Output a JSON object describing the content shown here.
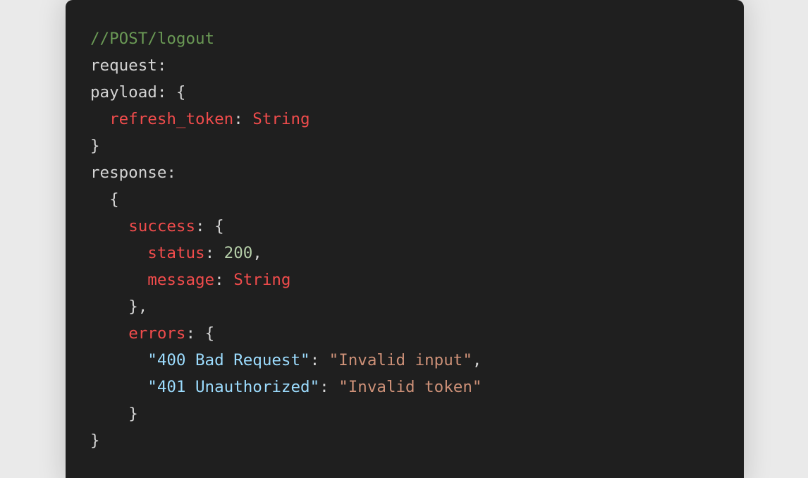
{
  "code": {
    "comment": "//POST/logout",
    "request_label": "request:",
    "payload_label": "payload:",
    "open_brace": "{",
    "close_brace": "}",
    "refresh_token_key": "refresh_token",
    "colon_sep": ": ",
    "refresh_token_type": "String",
    "response_label": "response:",
    "success_key": "success",
    "status_key": "status",
    "status_value": "200",
    "comma": ",",
    "message_key": "message",
    "message_type": "String",
    "close_brace_comma": "},",
    "errors_key": "errors",
    "error_400_key": "\"400 Bad Request\"",
    "error_400_value": "\"Invalid input\"",
    "error_401_key": "\"401 Unauthorized\"",
    "error_401_value": "\"Invalid token\""
  },
  "colors": {
    "background": "#1f1f1f",
    "comment": "#6a9955",
    "plain": "#d4d4d4",
    "key": "#f14c4c",
    "number": "#b5cea8",
    "string_key": "#9cdcfe",
    "string_value": "#ce9178"
  }
}
